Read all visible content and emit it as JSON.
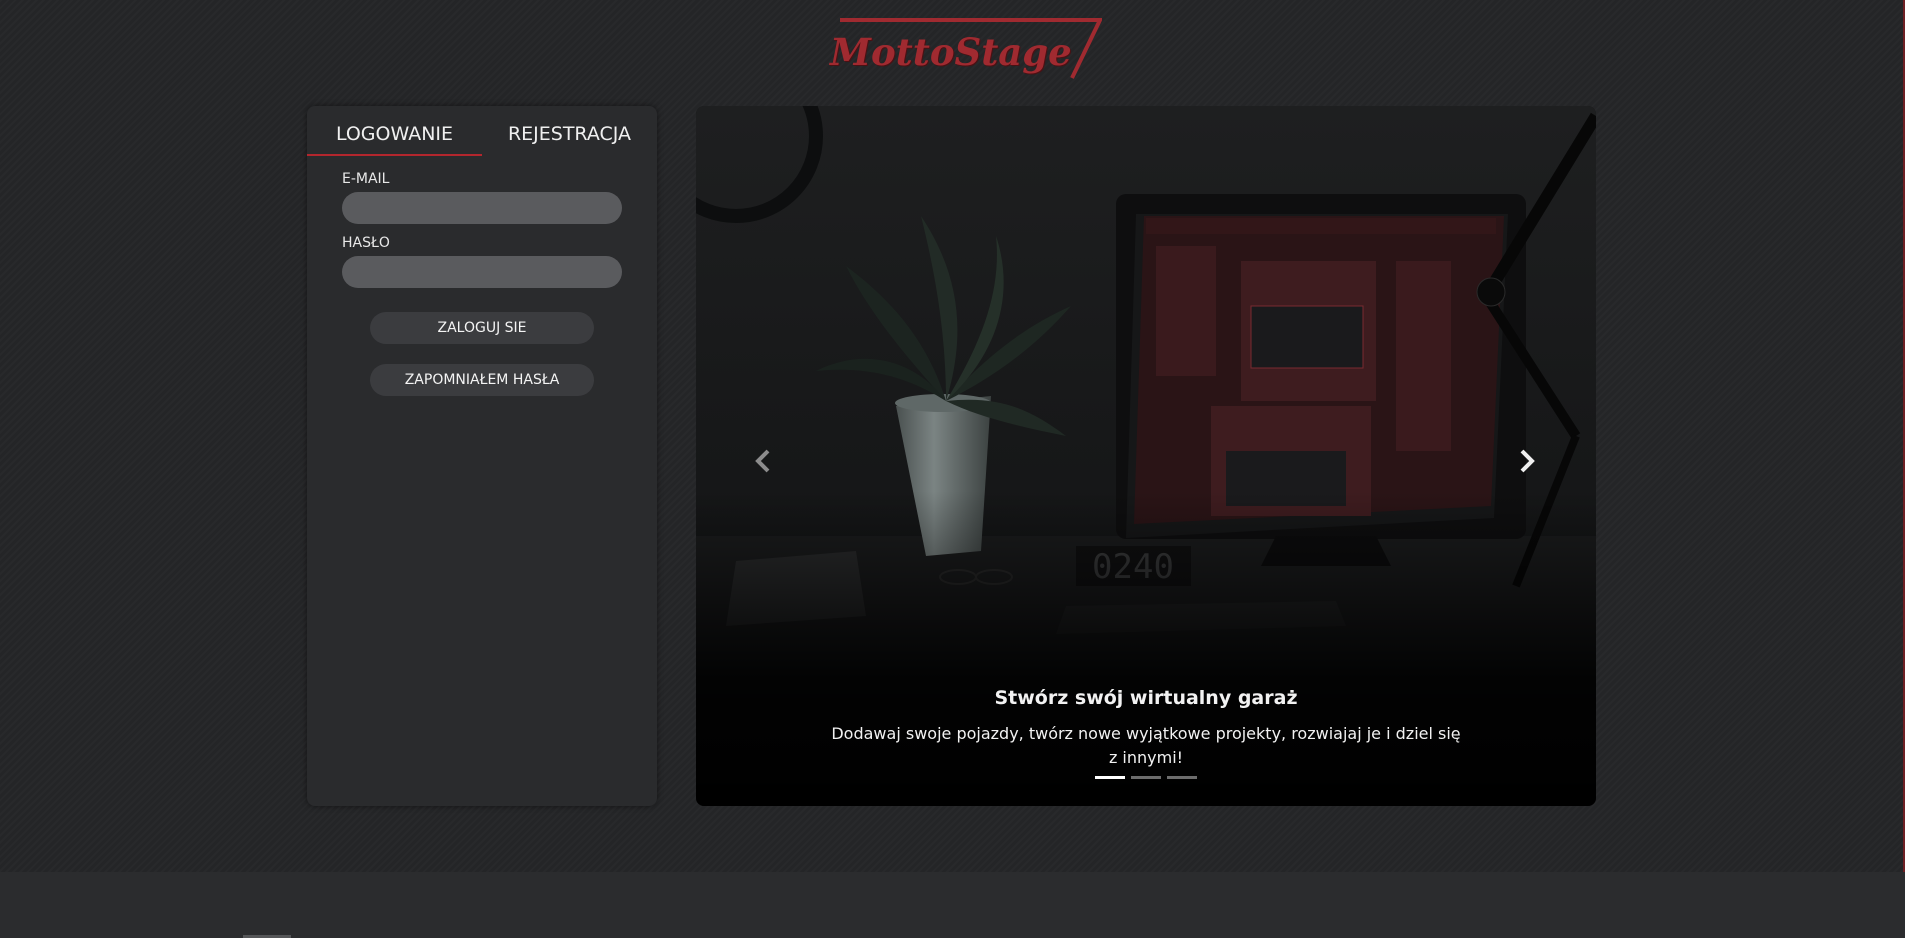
{
  "logo": {
    "text": "MottoStage",
    "icon": "piston-icon"
  },
  "auth": {
    "tabs": [
      {
        "label": "LOGOWANIE",
        "active": true
      },
      {
        "label": "REJESTRACJA",
        "active": false
      }
    ],
    "email_label": "E-MAIL",
    "email_value": "",
    "password_label": "HASŁO",
    "password_value": "",
    "login_button": "ZALOGUJ SIE",
    "forgot_button": "ZAPOMNIAŁEM HASŁA"
  },
  "carousel": {
    "slides": [
      {
        "title": "Stwórz swój wirtualny garaż",
        "text": "Dodawaj swoje pojazdy, twórz nowe wyjątkowe projekty, rozwiajaj je i dziel się z innymi!",
        "active": true
      },
      {
        "active": false
      },
      {
        "active": false
      }
    ],
    "clock_text": "0240",
    "prev_icon": "chevron-left-icon",
    "next_icon": "chevron-right-icon"
  },
  "colors": {
    "accent": "#b3262d",
    "background": "#242527",
    "panel": "#2a2b2d",
    "input": "#5a5b5e"
  }
}
